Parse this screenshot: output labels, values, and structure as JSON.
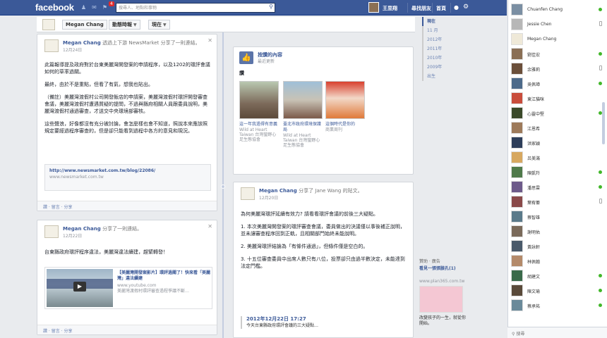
{
  "topbar": {
    "logo": "facebook",
    "search_placeholder": "搜尋人、地點和事物",
    "notifications_count": "4",
    "user_link": "王昱翔",
    "find_friends": "尋找朋友",
    "home": "首頁"
  },
  "timeline_bar": {
    "name_button": "Megan Chang",
    "timeline_button": "動態時報",
    "now_button": "現在"
  },
  "year_nav": [
    "現在",
    "11 月",
    "2012年",
    "2011年",
    "2010年",
    "2009年",
    "出生"
  ],
  "posts": [
    {
      "author": "Megan Chang",
      "action": "透過上下游 NewsMarket 分享了一則連結。",
      "time": "12月24日",
      "body": [
        "此篇報導提及政府對於台東美麗灣開發案的申請程序，以及1202的環評會議如何的草率過關。",
        "最終，由於不是重點，但看了有氣，想我也貼出。",
        "（備註）美麗灣渡假村公司開發飯店的申請案，美麗灣渡假村環評開發審查會議，美麗灣渡假村遭遇質疑的提問，不過與縣府相關人員跟委員說明，美麗灣渡假村通過審查，才送交中央環境部審核。",
        "這些聲浪，好像都沒有充分被討論，會怎麼樣也會不知道，照說本來應該照規定要經過程序審查的，但是卻只能看到過程中各方的意見和現況。"
      ],
      "link_url": "http://www.newsmarket.com.tw/blog/22086/",
      "link_host": "www.newsmarket.com.tw",
      "footer": "讚 · 留言 · 分享"
    },
    {
      "author": "Megan Chang",
      "action": "分享了一則連結。",
      "time": "12月22日",
      "body": [
        "台東縣政府環評程序違法，美麗灣違法續建，趕緊轉發！"
      ],
      "video_title": "【美麗灣開發案影片】環評過關了！快來看「美麗灣」違法續建",
      "video_host": "www.youtube.com",
      "video_desc": "美麗灣渡假村環評審查過程爭議不斷…",
      "footer": "讚 · 留言 · 分享"
    },
    {
      "author": "Megan Chang",
      "action": "分享了 Jane Wang 的貼文。",
      "time": "12月20日",
      "body": [
        "為何美麗灣環評延續有效力? 請看看環評會議的前後三大疑點。",
        "1. 本次美麗灣開發案的環評審查會議，委員做出的決議僅以事後補正說明，並未讓審查程序回到正軌，且相關部門始終未能說明。",
        "2. 美麗灣環評結論為「有條件通過」，但條件僅是空白的。",
        "3. 十五位審查委員中出席人數只有八位，投票卻只由過半數決定，未能達到法定門檻。"
      ],
      "quote_date": "2012年12月22日 17:27",
      "quote_text": "今天台東縣政府環評會議的三大疑點…",
      "footer": "讚 · 留言 · 分享"
    }
  ],
  "likes_card": {
    "title": "按讚的內容",
    "subtitle": "最近更新",
    "section": "讚",
    "items": [
      {
        "name": "這一年我過得有意義",
        "sub": "Wild at Heart Taiwan 台灣蠻野心足生態協會"
      },
      {
        "name": "臺北市政府環境保護局",
        "sub": "Wild at Heart Taiwan 台灣蠻野心足生態協會"
      },
      {
        "name": "這個時代是你的",
        "sub": "商業周刊"
      }
    ]
  },
  "ad": {
    "label": "贊助 · 廣告",
    "title": "看見一張張臉孔(1)",
    "host": "www.plan365.com.tw",
    "text": "改變孩子的一生，就從你開始。"
  },
  "chat": {
    "search": "搜尋",
    "friends": [
      {
        "name": "Chuanfen Chang",
        "status": "online"
      },
      {
        "name": "Jessie Chen",
        "status": "mobile"
      },
      {
        "name": "Megan Chang",
        "status": ""
      },
      {
        "name": "劉佳宏",
        "status": "online"
      },
      {
        "name": "余雅莉",
        "status": "mobile"
      },
      {
        "name": "吳佩璋",
        "status": "online"
      },
      {
        "name": "東江貓咪",
        "status": ""
      },
      {
        "name": "心靈中堅",
        "status": "online"
      },
      {
        "name": "江恩希",
        "status": ""
      },
      {
        "name": "洪家穎",
        "status": ""
      },
      {
        "name": "呂美滿",
        "status": ""
      },
      {
        "name": "陳凱羚",
        "status": "online"
      },
      {
        "name": "潘思雲",
        "status": "online"
      },
      {
        "name": "葉宥蓁",
        "status": "mobile"
      },
      {
        "name": "蔡智雄",
        "status": ""
      },
      {
        "name": "謝明佑",
        "status": ""
      },
      {
        "name": "黃詠軒",
        "status": ""
      },
      {
        "name": "林佩翰",
        "status": ""
      },
      {
        "name": "胡建文",
        "status": "online"
      },
      {
        "name": "陳文瑜",
        "status": "online"
      },
      {
        "name": "蔡承祐",
        "status": "online"
      }
    ]
  }
}
